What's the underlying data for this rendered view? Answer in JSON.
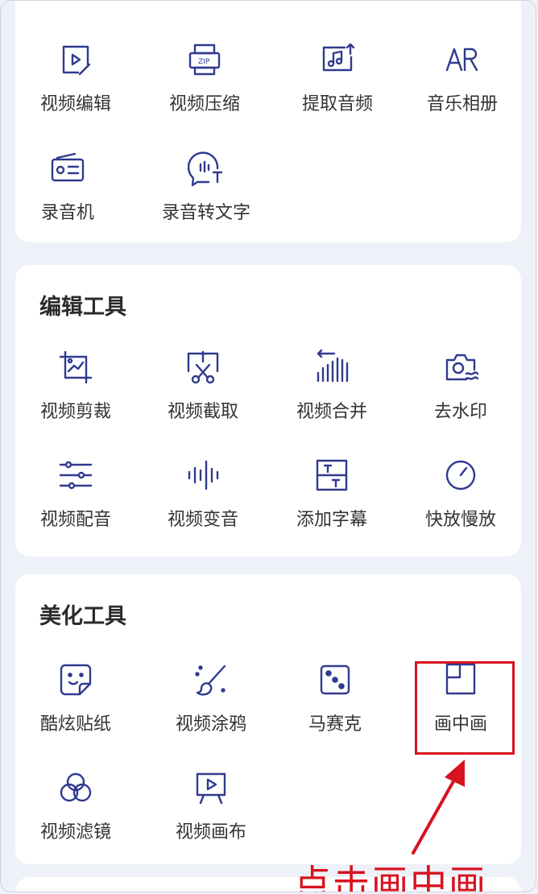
{
  "section_top": {
    "items": [
      {
        "label": "视频编辑",
        "icon": "video-edit-icon"
      },
      {
        "label": "视频压缩",
        "icon": "zip-compress-icon"
      },
      {
        "label": "提取音频",
        "icon": "extract-audio-icon"
      },
      {
        "label": "音乐相册",
        "icon": "ar-album-icon"
      },
      {
        "label": "录音机",
        "icon": "radio-recorder-icon"
      },
      {
        "label": "录音转文字",
        "icon": "speech-to-text-icon"
      }
    ]
  },
  "section_edit": {
    "title": "编辑工具",
    "items": [
      {
        "label": "视频剪裁",
        "icon": "crop-icon"
      },
      {
        "label": "视频截取",
        "icon": "scissors-clip-icon"
      },
      {
        "label": "视频合并",
        "icon": "merge-bars-icon"
      },
      {
        "label": "去水印",
        "icon": "camera-watermark-icon"
      },
      {
        "label": "视频配音",
        "icon": "sliders-icon"
      },
      {
        "label": "视频变音",
        "icon": "waveform-icon"
      },
      {
        "label": "添加字幕",
        "icon": "subtitle-icon"
      },
      {
        "label": "快放慢放",
        "icon": "speed-gauge-icon"
      }
    ]
  },
  "section_beautify": {
    "title": "美化工具",
    "items": [
      {
        "label": "酷炫贴纸",
        "icon": "sticker-face-icon"
      },
      {
        "label": "视频涂鸦",
        "icon": "paint-brush-icon"
      },
      {
        "label": "马赛克",
        "icon": "mosaic-dice-icon"
      },
      {
        "label": "画中画",
        "icon": "picture-in-picture-icon"
      },
      {
        "label": "视频滤镜",
        "icon": "filter-circles-icon"
      },
      {
        "label": "视频画布",
        "icon": "canvas-easel-icon"
      }
    ]
  },
  "annotation": {
    "text": "点击画中画"
  },
  "colors": {
    "accent": "#2f3a8f",
    "highlight": "#d8121f",
    "background": "#eef1f8"
  }
}
